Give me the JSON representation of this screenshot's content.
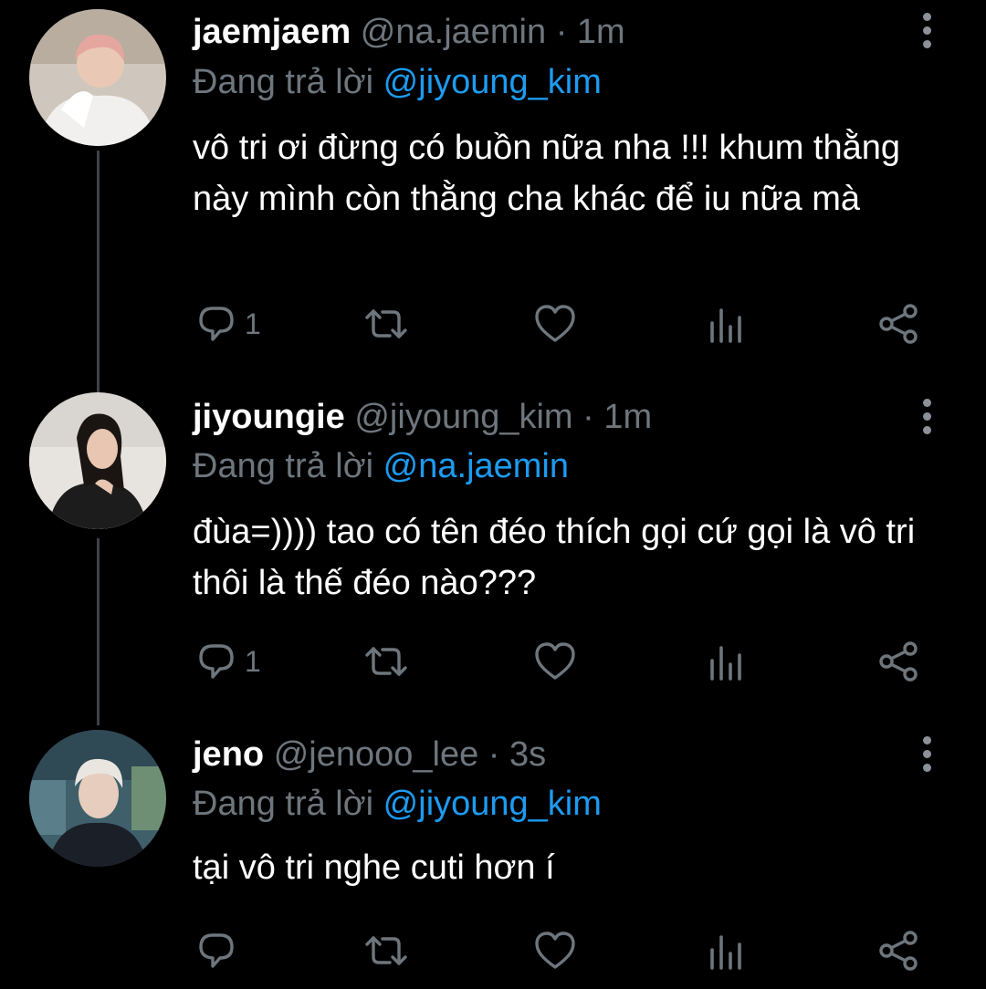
{
  "tweets": [
    {
      "name": "jaemjaem",
      "handle": "@na.jaemin",
      "separator": "·",
      "time": "1m",
      "reply_prefix": "Đang trả lời",
      "reply_to": "@jiyoung_kim",
      "text": "vô tri ơi đừng có buồn nữa nha !!! khum thằng này mình còn thằng cha khác để iu nữa mà",
      "reply_count": "1"
    },
    {
      "name": "jiyoungie",
      "handle": "@jiyoung_kim",
      "separator": "·",
      "time": "1m",
      "reply_prefix": "Đang trả lời",
      "reply_to": "@na.jaemin",
      "text": "đùa=)))) tao có tên đéo thích gọi cứ gọi là vô tri thôi là thế đéo nào???",
      "reply_count": "1"
    },
    {
      "name": "jeno",
      "handle": "@jenooo_lee",
      "separator": "·",
      "time": "3s",
      "reply_prefix": "Đang trả lời",
      "reply_to": "@jiyoung_kim",
      "text": "tại vô tri nghe cuti hơn í",
      "reply_count": ""
    }
  ],
  "icons": {
    "reply": "reply-bubble-icon",
    "retweet": "retweet-icon",
    "like": "heart-icon",
    "stats": "analytics-icon",
    "share": "share-icon",
    "more": "more-vertical-icon"
  },
  "colors": {
    "background": "#000000",
    "text": "#ffffff",
    "muted": "#6e767d",
    "mention": "#1d9bf0",
    "thread_line": "#3d4247"
  }
}
